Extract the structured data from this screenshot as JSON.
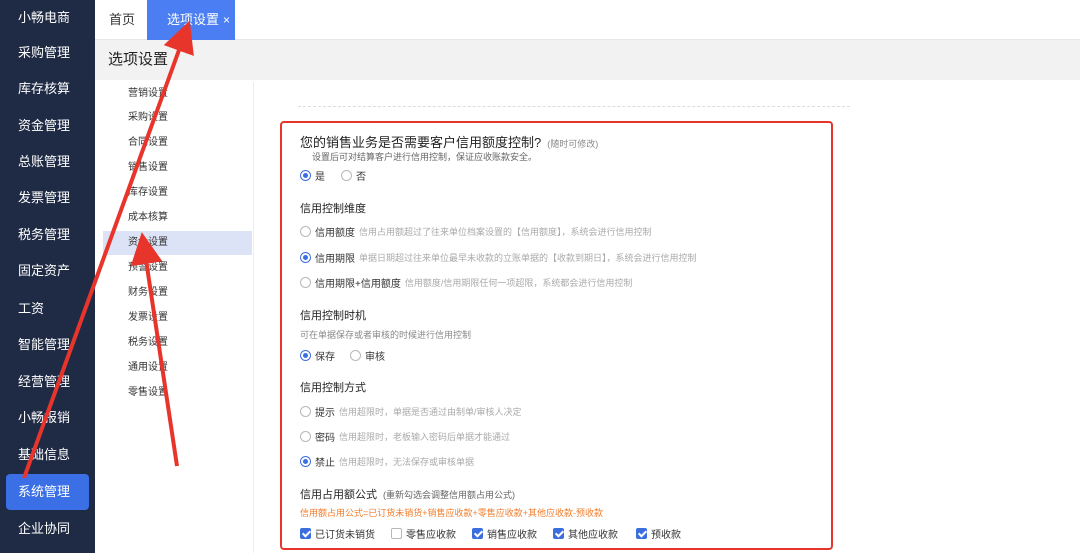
{
  "sidebar": {
    "items": [
      {
        "label": "小畅电商"
      },
      {
        "label": "采购管理"
      },
      {
        "label": "库存核算"
      },
      {
        "label": "资金管理"
      },
      {
        "label": "总账管理"
      },
      {
        "label": "发票管理"
      },
      {
        "label": "税务管理"
      },
      {
        "label": "固定资产"
      },
      {
        "label": "工资"
      },
      {
        "label": "智能管理"
      },
      {
        "label": "经营管理"
      },
      {
        "label": "小畅报销"
      },
      {
        "label": "基础信息"
      },
      {
        "label": "系统管理"
      },
      {
        "label": "企业协同"
      }
    ],
    "active_index": 13
  },
  "tabs": {
    "home": "首页",
    "active": "选项设置",
    "close": "×"
  },
  "page": {
    "title": "选项设置"
  },
  "submenu": {
    "items": [
      "营销设置",
      "采购设置",
      "合同设置",
      "销售设置",
      "库存设置",
      "成本核算",
      "资金设置",
      "预警设置",
      "财务设置",
      "发票设置",
      "税务设置",
      "通用设置",
      "零售设置"
    ],
    "active_index": 6
  },
  "credit": {
    "question": "您的销售业务是否需要客户信用额度控制?",
    "question_note": "(随时可修改)",
    "question_desc": "设置后可对结算客户进行信用控制，保证应收账款安全。",
    "enable_options": [
      {
        "label": "是",
        "checked": true
      },
      {
        "label": "否",
        "checked": false
      }
    ],
    "dimension": {
      "title": "信用控制维度",
      "options": [
        {
          "label": "信用额度",
          "desc": "信用占用额超过了往来单位档案设置的【信用额度】，系统会进行信用控制",
          "checked": false
        },
        {
          "label": "信用期限",
          "desc": "单据日期超过往来单位最早未收款的立账单据的【收款到期日】，系统会进行信用控制",
          "checked": true
        },
        {
          "label": "信用期限+信用额度",
          "desc": "信用额度/信用期限任何一项超限，系统都会进行信用控制",
          "checked": false
        }
      ]
    },
    "timing": {
      "title": "信用控制时机",
      "desc": "可在单据保存或者审核的时候进行信用控制",
      "options": [
        {
          "label": "保存",
          "checked": true
        },
        {
          "label": "审核",
          "checked": false
        }
      ]
    },
    "method": {
      "title": "信用控制方式",
      "options": [
        {
          "label": "提示",
          "desc": "信用超限时，单据是否通过由制单/审核人决定",
          "checked": false
        },
        {
          "label": "密码",
          "desc": "信用超限时，老板输入密码后单据才能通过",
          "checked": false
        },
        {
          "label": "禁止",
          "desc": "信用超限时，无法保存或审核单据",
          "checked": true
        }
      ]
    },
    "formula": {
      "title": "信用占用额公式",
      "note": "(重新勾选会调整信用额占用公式)",
      "text": "信用额占用公式=已订货未销货+销售应收款+零售应收款+其他应收款-预收款",
      "checkboxes": [
        {
          "label": "已订货未销货",
          "checked": true
        },
        {
          "label": "零售应收款",
          "checked": false
        },
        {
          "label": "销售应收款",
          "checked": true
        },
        {
          "label": "其他应收款",
          "checked": true
        },
        {
          "label": "预收款",
          "checked": true
        }
      ]
    }
  },
  "colors": {
    "sidebar_bg": "#1f2a44",
    "accent": "#3a6fe6",
    "annotation_red": "#e8352c",
    "formula_orange": "#f07d2c"
  }
}
